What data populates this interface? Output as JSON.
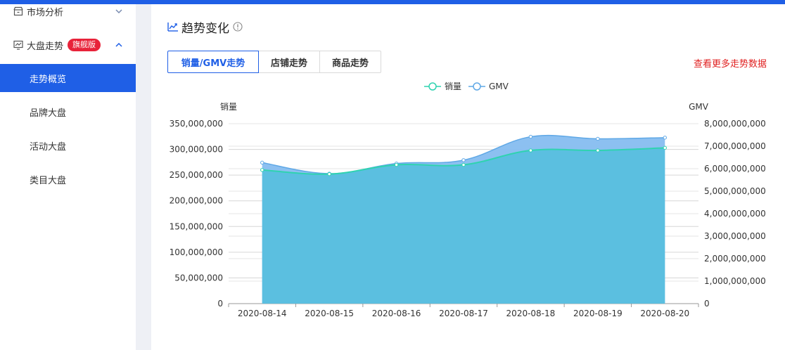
{
  "sidebar": {
    "group_market": {
      "label": "市场分析",
      "icon": "shop-icon"
    },
    "group_trend": {
      "label": "大盘走势",
      "badge": "旗舰版",
      "icon": "trend-board-icon"
    },
    "items": [
      {
        "label": "走势概览",
        "active": true
      },
      {
        "label": "品牌大盘",
        "active": false
      },
      {
        "label": "活动大盘",
        "active": false
      },
      {
        "label": "类目大盘",
        "active": false
      }
    ]
  },
  "main": {
    "title": "趋势变化",
    "tabs": [
      {
        "label": "销量/GMV走势",
        "active": true
      },
      {
        "label": "店铺走势",
        "active": false
      },
      {
        "label": "商品走势",
        "active": false
      }
    ],
    "more_link": "查看更多走势数据"
  },
  "colors": {
    "accent": "#1f5fe6",
    "badge": "#e8233a",
    "sales_line": "#2fd3b0",
    "sales_fill": "#5bbfe0",
    "gmv_line": "#5fa8e6",
    "gmv_fill": "#86bdf0"
  },
  "chart_data": {
    "type": "area",
    "categories": [
      "2020-08-14",
      "2020-08-15",
      "2020-08-16",
      "2020-08-17",
      "2020-08-18",
      "2020-08-19",
      "2020-08-20"
    ],
    "series": [
      {
        "name": "销量",
        "axis": "left",
        "values": [
          260000000,
          252000000,
          270000000,
          270000000,
          298000000,
          298000000,
          303000000
        ]
      },
      {
        "name": "GMV",
        "axis": "right",
        "values": [
          6270000000,
          5780000000,
          6230000000,
          6380000000,
          7420000000,
          7330000000,
          7380000000
        ]
      }
    ],
    "ylabel_left": "销量",
    "ylabel_right": "GMV",
    "ylim_left": [
      0,
      350000000
    ],
    "ylim_right": [
      0,
      8000000000
    ],
    "yticks_left": [
      "0",
      "50,000,000",
      "100,000,000",
      "150,000,000",
      "200,000,000",
      "250,000,000",
      "300,000,000",
      "350,000,000"
    ],
    "yticks_right": [
      "0",
      "1,000,000,000",
      "2,000,000,000",
      "3,000,000,000",
      "4,000,000,000",
      "5,000,000,000",
      "6,000,000,000",
      "7,000,000,000",
      "8,000,000,000"
    ],
    "legend": [
      {
        "name": "销量"
      },
      {
        "name": "GMV"
      }
    ],
    "legend_position": "top-center",
    "grid": true
  }
}
